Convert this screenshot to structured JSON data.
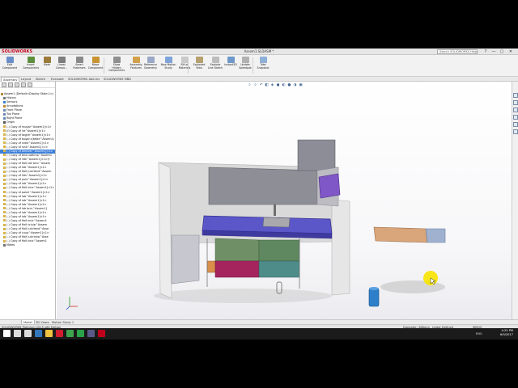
{
  "app": {
    "logo": "SOLIDWORKS",
    "window_title": "Assem1.SLDASM *",
    "search_placeholder": "Search SOLIDWORKS Help",
    "win_controls": [
      "?",
      "—",
      "▢",
      "✕"
    ]
  },
  "ribbon": {
    "buttons": [
      {
        "label": "Edit Component",
        "icon": "edit-component-icon",
        "color": "#6a8fc8"
      },
      {
        "label": "Insert Components",
        "icon": "insert-components-icon",
        "color": "#5d8f3e"
      },
      {
        "label": "Mate",
        "icon": "mate-icon",
        "color": "#9a7b3a"
      },
      {
        "label": "Linear Compo...",
        "icon": "linear-pattern-icon",
        "color": "#7e7e7e"
      },
      {
        "label": "Smart Fasteners",
        "icon": "smart-fasteners-icon",
        "color": "#8a8a8a"
      },
      {
        "label": "Move Component",
        "icon": "move-component-icon",
        "color": "#c89432"
      },
      {
        "label": "Show Hidden Components",
        "icon": "show-hidden-icon",
        "color": "#8f8f8f"
      },
      {
        "label": "Assembly Features",
        "icon": "assembly-features-icon",
        "color": "#d1a04a"
      },
      {
        "label": "Reference Geometry",
        "icon": "reference-geometry-icon",
        "color": "#9aa7c7"
      },
      {
        "label": "New Motion Study",
        "icon": "motion-study-icon",
        "color": "#7fa4d9"
      },
      {
        "label": "Bill of Materials",
        "icon": "bom-icon",
        "color": "#c9c9c9"
      },
      {
        "label": "Exploded View",
        "icon": "exploded-view-icon",
        "color": "#b7a070"
      },
      {
        "label": "Explode Line Sketch",
        "icon": "explode-line-icon",
        "color": "#bcbcbc"
      },
      {
        "label": "Instant3D",
        "icon": "instant3d-icon",
        "color": "#6f98c9"
      },
      {
        "label": "Update Speedpak",
        "icon": "speedpak-icon",
        "color": "#b2b2b2"
      },
      {
        "label": "Take Snapshot",
        "icon": "snapshot-icon",
        "color": "#8fb0d8"
      }
    ]
  },
  "tabs": [
    "Assembly",
    "Layout",
    "Sketch",
    "Evaluate",
    "SOLIDWORKS Add-Ins",
    "SOLIDWORKS MBD"
  ],
  "tree": {
    "filter": "",
    "items": [
      {
        "label": "Assem1 (Default<Display State-1>)",
        "icon": "assembly-icon",
        "selected": false
      },
      {
        "label": "History",
        "icon": "history-icon",
        "selected": false
      },
      {
        "label": "Sensors",
        "icon": "sensors-icon",
        "selected": false
      },
      {
        "label": "Annotations",
        "icon": "annotations-icon",
        "selected": false
      },
      {
        "label": "Front Plane",
        "icon": "plane-icon",
        "selected": false
      },
      {
        "label": "Top Plane",
        "icon": "plane-icon",
        "selected": false
      },
      {
        "label": "Right Plane",
        "icon": "plane-icon",
        "selected": false
      },
      {
        "label": "Origin",
        "icon": "origin-icon",
        "selected": false
      },
      {
        "label": "(-) Copy of mugar^Assem1]<1>",
        "icon": "part-icon",
        "selected": false
      },
      {
        "label": "(f) Copy of lid^Assem1]<1>",
        "icon": "part-icon",
        "selected": false
      },
      {
        "label": "(-) Copy of tagjdr^Assem1]<1>",
        "icon": "part-icon",
        "selected": false
      },
      {
        "label": "(-) Copy of bugar.c(table^Assem1)",
        "icon": "part-icon",
        "selected": false
      },
      {
        "label": "(-) Copy of sneo^Assem1]<1>",
        "icon": "part-icon",
        "selected": false
      },
      {
        "label": "(-) Copy of sink^Assem1]<1>",
        "icon": "part-icon",
        "selected": false
      },
      {
        "label": "(-) Copy of blender^Assem1]<1>",
        "icon": "part-icon",
        "selected": true
      },
      {
        "label": "(-) Copy of bilui.satkmp^Assem1",
        "icon": "part-icon",
        "selected": false
      },
      {
        "label": "(-) Copy of lide^Assem1]<1>(t",
        "icon": "part-icon",
        "selected": false
      },
      {
        "label": "(-) Copy of fiolt lait bnic^Assem",
        "icon": "part-icon",
        "selected": false
      },
      {
        "label": "(-) Copy of lob^Assem1]<1>",
        "icon": "part-icon",
        "selected": false
      },
      {
        "label": "(-) Copy of fiolt julo'tend^Assem",
        "icon": "part-icon",
        "selected": false
      },
      {
        "label": "(-) Copy of lids^Assem1]<1>",
        "icon": "part-icon",
        "selected": false
      },
      {
        "label": "(-) Copy of pulo^Assem1]<1>",
        "icon": "part-icon",
        "selected": false
      },
      {
        "label": "(-) Copy of lob^Assem1]<1>",
        "icon": "part-icon",
        "selected": false
      },
      {
        "label": "(-) Copy of fiolt bnic^Assem1]<1>",
        "icon": "part-icon",
        "selected": false
      },
      {
        "label": "(-) Copy of polo2^Assem1]<1>",
        "icon": "part-icon",
        "selected": false
      },
      {
        "label": "(-) Copy of lob^Assem1]<1>",
        "icon": "part-icon",
        "selected": false
      },
      {
        "label": "(-) Copy of lob^Assem1]<1>",
        "icon": "part-icon",
        "selected": false
      },
      {
        "label": "(-) Copy of lob^Assem1]<1>",
        "icon": "part-icon",
        "selected": false
      },
      {
        "label": "(-) Copy of lob bnic^Assem1]",
        "icon": "part-icon",
        "selected": false
      },
      {
        "label": "(-) Copy of lob^Assem1]<1>",
        "icon": "part-icon",
        "selected": false
      },
      {
        "label": "(-) Copy of lob^Assem1]<1>",
        "icon": "part-icon",
        "selected": false
      },
      {
        "label": "(-) Copy of fiolt bnic^Assem1",
        "icon": "part-icon",
        "selected": false
      },
      {
        "label": "(-) Copy of fiolt tciuip^Assem",
        "icon": "part-icon",
        "selected": false
      },
      {
        "label": "(-) Copy of fiolt julo'tend^Asse",
        "icon": "part-icon",
        "selected": false
      },
      {
        "label": "(-) Copy of cuup^Assem1]<1>",
        "icon": "part-icon",
        "selected": false
      },
      {
        "label": "(-) Copy of fiolt julo'cotp^Asse",
        "icon": "part-icon",
        "selected": false
      },
      {
        "label": "(-) Copy of fiolt bnic^Assem1",
        "icon": "part-icon",
        "selected": false
      },
      {
        "label": "Mates",
        "icon": "mates-icon",
        "selected": false
      }
    ]
  },
  "bottom_tabs": [
    "Model",
    "3D Views",
    "Motion Study 1"
  ],
  "status": {
    "edition": "SOLIDWORKS Premium 2015 x64 Edition",
    "diameter": "Diameter: 386mm",
    "definition": "Under Defined",
    "units": "MMGS"
  },
  "taskbar": {
    "time": "4:25 PM",
    "date": "6/9/2017",
    "lang": "ENG",
    "icons": [
      {
        "name": "start-icon",
        "color": "#ffffff"
      },
      {
        "name": "search-taskbar-icon",
        "color": "#dcdcdc"
      },
      {
        "name": "task-view-icon",
        "color": "#dcdcdc"
      },
      {
        "name": "edge-icon",
        "color": "#3277bc"
      },
      {
        "name": "explorer-icon",
        "color": "#f0c340"
      },
      {
        "name": "opera-icon",
        "color": "#d01e2e"
      },
      {
        "name": "chrome-icon",
        "color": "#3fa34d"
      },
      {
        "name": "camtasia-icon",
        "color": "#2aa34b"
      },
      {
        "name": "app-icon",
        "color": "#5a5a8a"
      },
      {
        "name": "solidworks-icon",
        "color": "#c0001a"
      }
    ]
  },
  "colors": {
    "accent": "#3b7fd9",
    "selection": "#3b7fd9"
  }
}
